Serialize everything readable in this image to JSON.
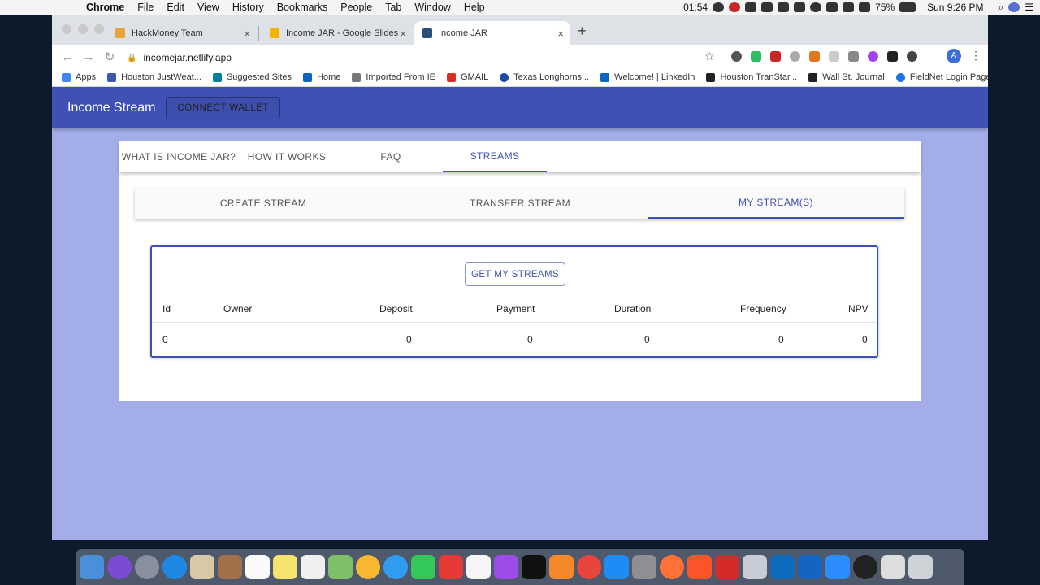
{
  "menubar": {
    "app": "Chrome",
    "items": [
      "File",
      "Edit",
      "View",
      "History",
      "Bookmarks",
      "People",
      "Tab",
      "Window",
      "Help"
    ],
    "time_counter": "01:54",
    "battery": "75%",
    "datetime": "Sun 9:26 PM"
  },
  "browser": {
    "tabs": [
      {
        "title": "HackMoney Team",
        "favicon_color": "#e8a33a"
      },
      {
        "title": "Income JAR - Google Slides",
        "favicon_color": "#f4b400"
      },
      {
        "title": "Income JAR",
        "favicon_color": "#2a4d7a"
      }
    ],
    "url": "incomejar.netlify.app",
    "profile_initial": "A",
    "bookmarks": [
      {
        "label": "Apps",
        "color": "#4285f4"
      },
      {
        "label": "Houston JustWeat...",
        "color": "#3b5ba9"
      },
      {
        "label": "Suggested Sites",
        "color": "#00809d"
      },
      {
        "label": "Home",
        "color": "#0a66c2"
      },
      {
        "label": "Imported From IE",
        "color": "#777777"
      },
      {
        "label": "GMAIL",
        "color": "#d93025"
      },
      {
        "label": "Texas Longhorns...",
        "color": "#1a4fa0"
      },
      {
        "label": "Welcome! | LinkedIn",
        "color": "#0a66c2"
      },
      {
        "label": "Houston TranStar...",
        "color": "#222222"
      },
      {
        "label": "Wall St. Journal",
        "color": "#222222"
      },
      {
        "label": "FieldNet Login Page",
        "color": "#1a73e8"
      }
    ],
    "bookmarks_more": "»"
  },
  "app": {
    "title": "Income Stream",
    "connect_wallet": "CONNECT WALLET",
    "main_tabs": [
      "WHAT IS INCOME JAR?",
      "HOW IT WORKS",
      "FAQ",
      "STREAMS"
    ],
    "main_tab_active": "STREAMS",
    "sub_tabs": [
      "CREATE STREAM",
      "TRANSFER STREAM",
      "MY STREAM(S)"
    ],
    "sub_tab_active": "MY STREAM(S)",
    "get_streams_button": "GET MY STREAMS",
    "table": {
      "headers": [
        "Id",
        "Owner",
        "Deposit",
        "Payment",
        "Duration",
        "Frequency",
        "NPV"
      ],
      "rows": [
        [
          "0",
          "",
          "0",
          "0",
          "0",
          "0",
          "0"
        ]
      ]
    },
    "colors": {
      "primary": "#3f51b5",
      "background": "#a3aee8"
    }
  }
}
